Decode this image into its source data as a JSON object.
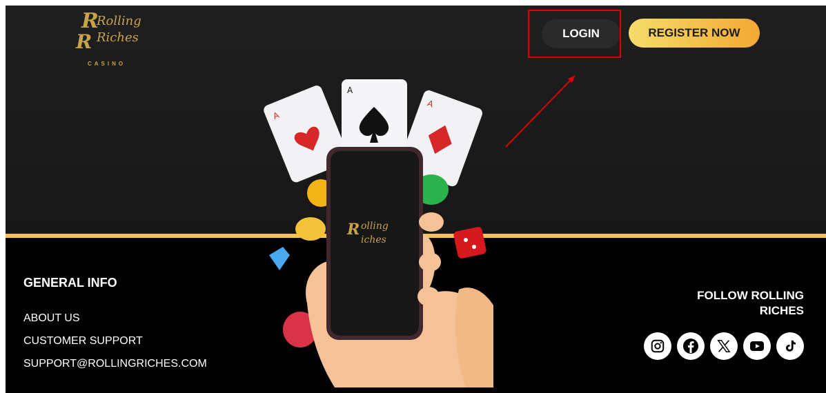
{
  "header": {
    "logo": {
      "line1": "Rolling",
      "line2": "Riches",
      "sub": "CASINO"
    },
    "login_label": "LOGIN",
    "register_label": "REGISTER NOW"
  },
  "footer": {
    "general_info": {
      "title": "GENERAL INFO",
      "links": [
        "ABOUT US",
        "CUSTOMER SUPPORT",
        "SUPPORT@ROLLINGRICHES.COM"
      ]
    },
    "follow": {
      "title_line1": "FOLLOW ROLLING",
      "title_line2": "RICHES",
      "icons": [
        "instagram-icon",
        "facebook-icon",
        "x-icon",
        "youtube-icon",
        "tiktok-icon"
      ]
    }
  },
  "colors": {
    "accent_gold": "#f4c542",
    "register_gradient_start": "#f6dc6a",
    "register_gradient_end": "#f2a933",
    "highlight_red": "#e00000"
  }
}
